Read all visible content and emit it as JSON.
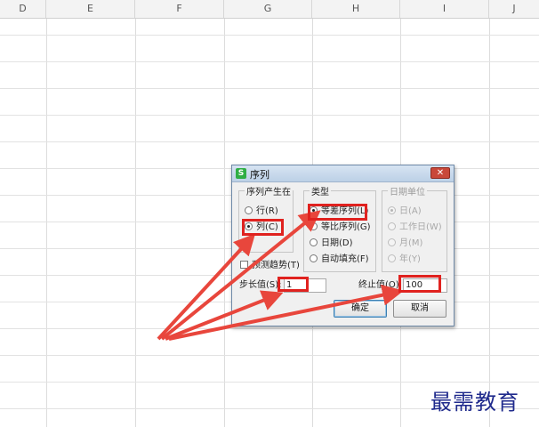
{
  "spreadsheet": {
    "columns": [
      "D",
      "E",
      "F",
      "G",
      "H",
      "I",
      "J"
    ]
  },
  "dialog": {
    "title": "序列",
    "app_icon_letter": "S",
    "close_symbol": "✕",
    "series_in": {
      "label": "序列产生在",
      "options": [
        {
          "label": "行(R)",
          "selected": false
        },
        {
          "label": "列(C)",
          "selected": true
        }
      ]
    },
    "type": {
      "label": "类型",
      "options": [
        {
          "label": "等差序列(L)",
          "selected": true
        },
        {
          "label": "等比序列(G)",
          "selected": false
        },
        {
          "label": "日期(D)",
          "selected": false
        },
        {
          "label": "自动填充(F)",
          "selected": false
        }
      ]
    },
    "date_unit": {
      "label": "日期单位",
      "disabled": true,
      "options": [
        {
          "label": "日(A)",
          "selected": true
        },
        {
          "label": "工作日(W)",
          "selected": false
        },
        {
          "label": "月(M)",
          "selected": false
        },
        {
          "label": "年(Y)",
          "selected": false
        }
      ]
    },
    "trend": {
      "label": "预测趋势(T)",
      "checked": false
    },
    "step": {
      "label": "步长值(S):",
      "value": "1"
    },
    "stop": {
      "label": "终止值(O):",
      "value": "100"
    },
    "ok_label": "确定",
    "cancel_label": "取消"
  },
  "annotation": {
    "highlight_color": "#e0221f",
    "arrow_color": "#e8463c"
  },
  "watermark": "最需教育"
}
